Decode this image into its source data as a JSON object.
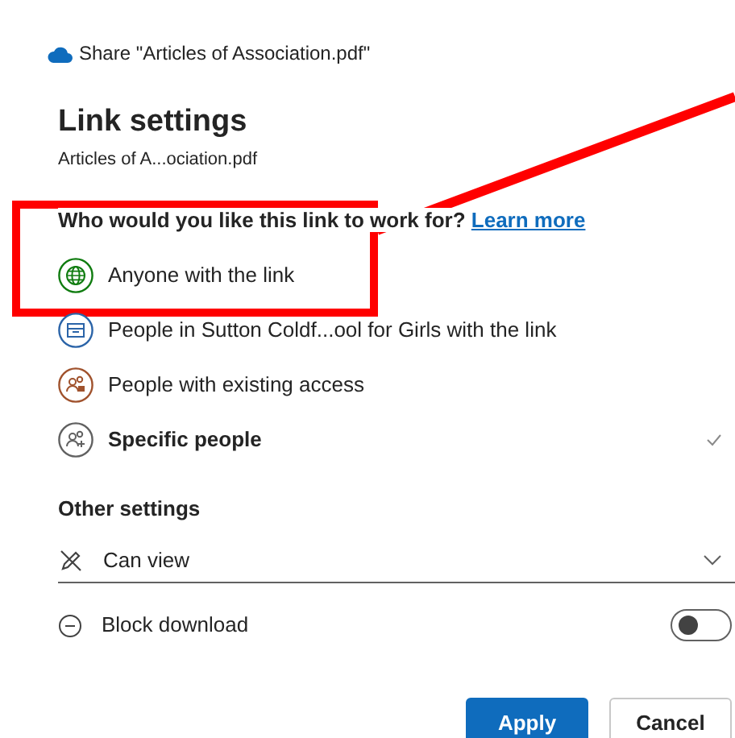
{
  "window": {
    "title": "Share \"Articles of Association.pdf\""
  },
  "heading": "Link settings",
  "file_name": "Articles of A...ociation.pdf",
  "question": {
    "text": "Who would you like this link to work for?",
    "link": "Learn more"
  },
  "options": [
    {
      "label": "Anyone with the link",
      "selected": false
    },
    {
      "label": "People in Sutton Coldf...ool for Girls with the link",
      "selected": false
    },
    {
      "label": "People with existing access",
      "selected": false
    },
    {
      "label": "Specific people",
      "selected": true
    }
  ],
  "other_settings": {
    "heading": "Other settings",
    "permission": "Can view",
    "block_download": {
      "label": "Block download",
      "on": false
    }
  },
  "buttons": [
    {
      "label": "Apply",
      "kind": "primary"
    },
    {
      "label": "Cancel",
      "kind": "secondary"
    }
  ]
}
